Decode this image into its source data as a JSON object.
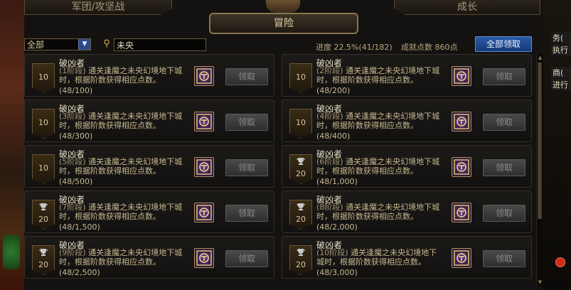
{
  "tabs": {
    "left": "军团/攻坚战",
    "right": "成长",
    "active": "冒险"
  },
  "hud": {
    "lines": [
      "务(",
      "执行",
      "商(",
      "进行"
    ]
  },
  "toolbar": {
    "filter_value": "全部",
    "search_value": "未央",
    "progress": "进度 22.5%(41/182)",
    "score": "成就点数 860点",
    "claim_all": "全部领取"
  },
  "achievements": [
    {
      "title": "破凶者",
      "stage": "(1阶段)",
      "desc": "通关逢魔之未央幻境地下城时，根据阶数获得相应点数。",
      "count": "(48/100)",
      "badge": "10",
      "trophy": false,
      "button": "领取"
    },
    {
      "title": "破凶者",
      "stage": "(2阶段)",
      "desc": "通关逢魔之未央幻境地下城时，根据阶数获得相应点数。",
      "count": "(48/200)",
      "badge": "10",
      "trophy": false,
      "button": "领取"
    },
    {
      "title": "破凶者",
      "stage": "(3阶段)",
      "desc": "通关逢魔之未央幻境地下城时，根据阶数获得相应点数。",
      "count": "(48/300)",
      "badge": "10",
      "trophy": false,
      "button": "领取"
    },
    {
      "title": "破凶者",
      "stage": "(4阶段)",
      "desc": "通关逢魔之未央幻境地下城时，根据阶数获得相应点数。",
      "count": "(48/400)",
      "badge": "10",
      "trophy": false,
      "button": "领取"
    },
    {
      "title": "破凶者",
      "stage": "(5阶段)",
      "desc": "通关逢魔之未央幻境地下城时，根据阶数获得相应点数。",
      "count": "(48/500)",
      "badge": "10",
      "trophy": false,
      "button": "领取"
    },
    {
      "title": "破凶者",
      "stage": "(6阶段)",
      "desc": "通关逢魔之未央幻境地下城时，根据阶数获得相应点数。",
      "count": "(48/1,000)",
      "badge": "20",
      "trophy": true,
      "button": "领取"
    },
    {
      "title": "破凶者",
      "stage": "(7阶段)",
      "desc": "通关逢魔之未央幻境地下城时，根据阶数获得相应点数。",
      "count": "(48/1,500)",
      "badge": "20",
      "trophy": true,
      "button": "领取"
    },
    {
      "title": "破凶者",
      "stage": "(8阶段)",
      "desc": "通关逢魔之未央幻境地下城时，根据阶数获得相应点数。",
      "count": "(48/2,000)",
      "badge": "20",
      "trophy": true,
      "button": "领取"
    },
    {
      "title": "破凶者",
      "stage": "(9阶段)",
      "desc": "通关逢魔之未央幻境地下城时，根据阶数获得相应点数。",
      "count": "(48/2,500)",
      "badge": "20",
      "trophy": true,
      "button": "领取"
    },
    {
      "title": "破凶者",
      "stage": "(10阶段)",
      "desc": "通关逢魔之未央幻境地下城时，根据阶数获得相应点数。",
      "count": "(48/3,000)",
      "badge": "20",
      "trophy": true,
      "button": "领取"
    }
  ]
}
